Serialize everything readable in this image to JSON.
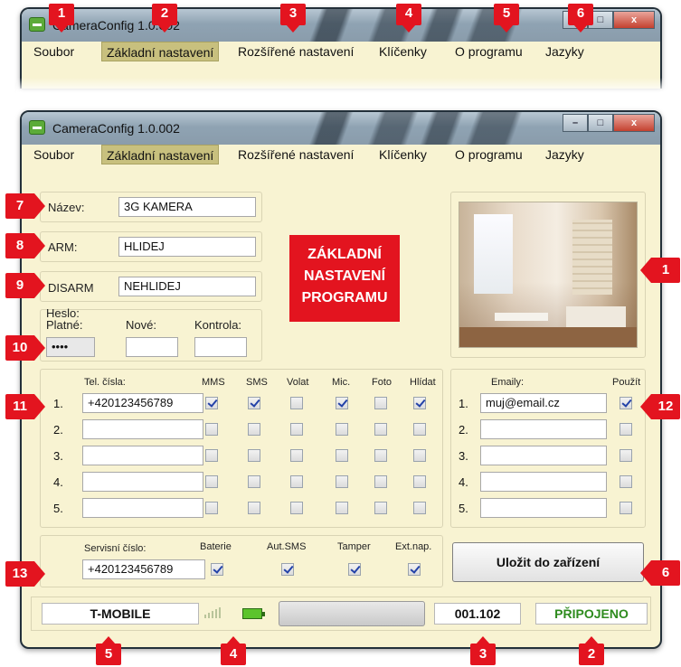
{
  "app_title": "CameraConfig 1.0.002",
  "window_controls": {
    "minimize": "–",
    "maximize": "□",
    "close": "x"
  },
  "menu": [
    "Soubor",
    "Základní nastavení",
    "Rozšířené nastavení",
    "Klíčenky",
    "O programu",
    "Jazyky"
  ],
  "active_menu": "Základní nastavení",
  "callout": {
    "line1": "ZÁKLADNÍ",
    "line2": "NASTAVENÍ",
    "line3": "PROGRAMU"
  },
  "fields": {
    "name_label": "Název:",
    "name_value": "3G KAMERA",
    "arm_label": "ARM:",
    "arm_value": "HLIDEJ",
    "disarm_label": "DISARM",
    "disarm_value": "NEHLIDEJ"
  },
  "password": {
    "title": "Heslo:",
    "valid_label": "Platné:",
    "new_label": "Nové:",
    "confirm_label": "Kontrola:",
    "valid_value": "••••",
    "new_value": "",
    "confirm_value": ""
  },
  "phones": {
    "header": "Tel. čísla:",
    "columns": [
      "MMS",
      "SMS",
      "Volat",
      "Mic.",
      "Foto",
      "Hlídat"
    ],
    "rows": [
      {
        "num": "1.",
        "value": "+420123456789",
        "checks": [
          true,
          true,
          false,
          true,
          false,
          true
        ]
      },
      {
        "num": "2.",
        "value": "",
        "checks": [
          false,
          false,
          false,
          false,
          false,
          false
        ]
      },
      {
        "num": "3.",
        "value": "",
        "checks": [
          false,
          false,
          false,
          false,
          false,
          false
        ]
      },
      {
        "num": "4.",
        "value": "",
        "checks": [
          false,
          false,
          false,
          false,
          false,
          false
        ]
      },
      {
        "num": "5.",
        "value": "",
        "checks": [
          false,
          false,
          false,
          false,
          false,
          false
        ]
      }
    ]
  },
  "emails": {
    "header": "Emaily:",
    "use_label": "Použít",
    "rows": [
      {
        "num": "1.",
        "value": "muj@email.cz",
        "checked": true
      },
      {
        "num": "2.",
        "value": "",
        "checked": false
      },
      {
        "num": "3.",
        "value": "",
        "checked": false
      },
      {
        "num": "4.",
        "value": "",
        "checked": false
      },
      {
        "num": "5.",
        "value": "",
        "checked": false
      }
    ]
  },
  "service": {
    "label": "Servisní číslo:",
    "value": "+420123456789",
    "columns": [
      "Baterie",
      "Aut.SMS",
      "Tamper",
      "Ext.nap."
    ],
    "checks": [
      true,
      true,
      true,
      true
    ]
  },
  "save_button": "Uložit do zařízení",
  "status": {
    "operator": "T-MOBILE",
    "version": "001.102",
    "connection": "PŘIPOJENO",
    "connection_color": "#2e8b1e",
    "signal_level": 0.0,
    "battery_level": 1.0
  },
  "markers": {
    "top": [
      "1",
      "2",
      "3",
      "4",
      "5",
      "6"
    ],
    "left": [
      "7",
      "8",
      "9",
      "10",
      "11",
      "13"
    ],
    "right_photo": "1",
    "right_email": "12",
    "right_save": "6",
    "bottom": [
      "5",
      "4",
      "3",
      "2"
    ]
  },
  "colors": {
    "marker_red": "#e3141f",
    "window_bg": "#f8f3d2",
    "active_menu_bg": "#c8c07e"
  }
}
